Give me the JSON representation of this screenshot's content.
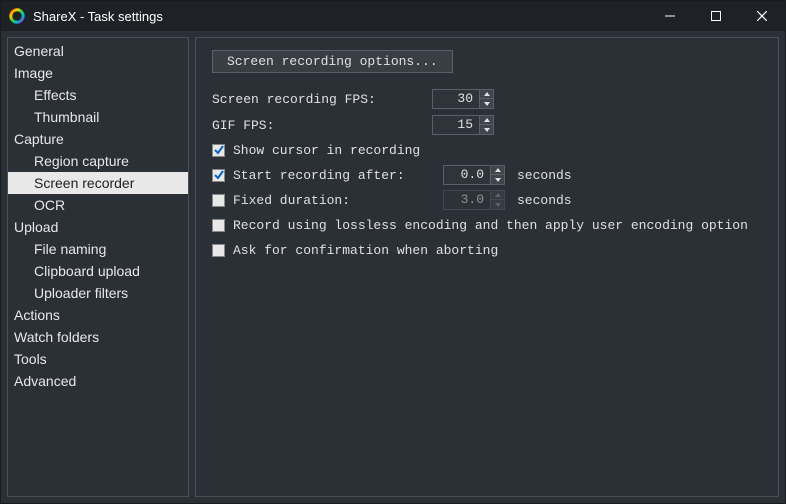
{
  "window": {
    "title": "ShareX - Task settings"
  },
  "sidebar": {
    "items": [
      {
        "label": "General",
        "level": 0,
        "selected": false
      },
      {
        "label": "Image",
        "level": 0,
        "selected": false
      },
      {
        "label": "Effects",
        "level": 1,
        "selected": false
      },
      {
        "label": "Thumbnail",
        "level": 1,
        "selected": false
      },
      {
        "label": "Capture",
        "level": 0,
        "selected": false
      },
      {
        "label": "Region capture",
        "level": 1,
        "selected": false
      },
      {
        "label": "Screen recorder",
        "level": 1,
        "selected": true
      },
      {
        "label": "OCR",
        "level": 1,
        "selected": false
      },
      {
        "label": "Upload",
        "level": 0,
        "selected": false
      },
      {
        "label": "File naming",
        "level": 1,
        "selected": false
      },
      {
        "label": "Clipboard upload",
        "level": 1,
        "selected": false
      },
      {
        "label": "Uploader filters",
        "level": 1,
        "selected": false
      },
      {
        "label": "Actions",
        "level": 0,
        "selected": false
      },
      {
        "label": "Watch folders",
        "level": 0,
        "selected": false
      },
      {
        "label": "Tools",
        "level": 0,
        "selected": false
      },
      {
        "label": "Advanced",
        "level": 0,
        "selected": false
      }
    ]
  },
  "panel": {
    "options_button": "Screen recording options...",
    "fps_label": "Screen recording FPS:",
    "fps_value": "30",
    "giffps_label": "GIF FPS:",
    "giffps_value": "15",
    "show_cursor": {
      "checked": true,
      "label": "Show cursor in recording"
    },
    "start_after": {
      "checked": true,
      "label": "Start recording after:",
      "value": "0.0",
      "unit": "seconds"
    },
    "fixed_duration": {
      "checked": false,
      "label": "Fixed duration:",
      "value": "3.0",
      "unit": "seconds"
    },
    "lossless": {
      "checked": false,
      "label": "Record using lossless encoding and then apply user encoding option"
    },
    "ask_abort": {
      "checked": false,
      "label": "Ask for confirmation when aborting"
    }
  }
}
